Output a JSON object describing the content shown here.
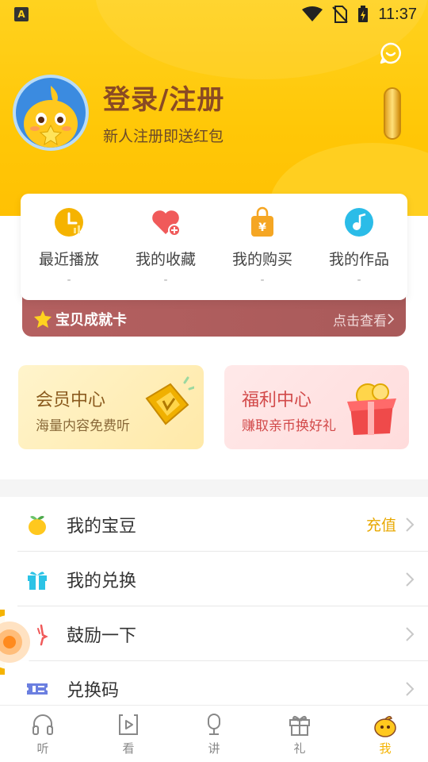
{
  "status_bar": {
    "app_badge": "A",
    "time": "11:37"
  },
  "profile": {
    "login_title": "登录/注册",
    "login_subtitle": "新人注册即送红包"
  },
  "quick_actions": [
    {
      "label": "最近播放",
      "count": "-",
      "icon": "clock-icon",
      "color": "#f5b300"
    },
    {
      "label": "我的收藏",
      "count": "-",
      "icon": "heart-icon",
      "color": "#f05a5a"
    },
    {
      "label": "我的购买",
      "count": "-",
      "icon": "shopping-bag-icon",
      "color": "#f5a623"
    },
    {
      "label": "我的作品",
      "count": "-",
      "icon": "music-note-icon",
      "color": "#2bbce8"
    }
  ],
  "achievement": {
    "title": "宝贝成就卡",
    "link": "点击查看"
  },
  "promos": {
    "vip": {
      "title": "会员中心",
      "subtitle": "海量内容免费听"
    },
    "welfare": {
      "title": "福利中心",
      "subtitle": "赚取亲币换好礼"
    }
  },
  "menu": [
    {
      "label": "我的宝豆",
      "extra": "充值",
      "icon": "bean-icon"
    },
    {
      "label": "我的兑换",
      "extra": "",
      "icon": "gift-icon"
    },
    {
      "label": "鼓励一下",
      "extra": "",
      "icon": "thumb-icon"
    },
    {
      "label": "兑换码",
      "extra": "",
      "icon": "ticket-icon"
    }
  ],
  "bottom_nav": [
    {
      "label": "听",
      "icon": "headphones-icon",
      "active": false
    },
    {
      "label": "看",
      "icon": "play-icon",
      "active": false
    },
    {
      "label": "讲",
      "icon": "microphone-icon",
      "active": false
    },
    {
      "label": "礼",
      "icon": "gift-box-icon",
      "active": false
    },
    {
      "label": "我",
      "icon": "me-mascot-icon",
      "active": true
    }
  ],
  "colors": {
    "brand_yellow": "#ffc707",
    "accent_orange": "#f5b300",
    "achievement_bg": "#b46060"
  }
}
